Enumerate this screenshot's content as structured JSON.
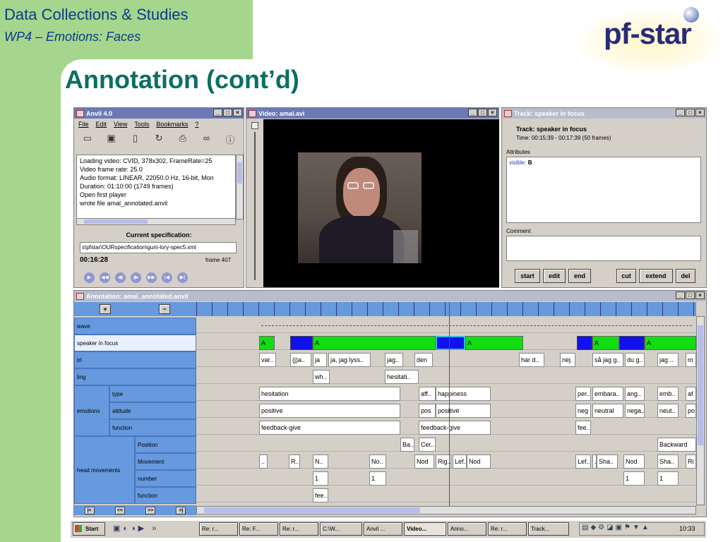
{
  "slide": {
    "header_title": "Data Collections & Studies",
    "header_subtitle": "WP4 – Emotions: Faces",
    "main_title": "Annotation (cont’d)",
    "logo_text": "pf-star",
    "colors": {
      "header_bg": "#a6d68d",
      "title": "#0b6e64",
      "accent": "#6b7ab5"
    }
  },
  "anvil": {
    "title": "Anvil 4.0",
    "menu": [
      "File",
      "Edit",
      "View",
      "Tools",
      "Bookmarks",
      "?"
    ],
    "log": [
      "Loading video: CVID, 378x302, FrameRate=25",
      "Video frame rate: 25.0",
      "Audio format: LINEAR, 22050.0 Hz, 16-bit, Mon",
      "Duration: 01:10:00 (1749 frames)",
      "Open first player",
      "wrote file amal_annotated.anvil"
    ],
    "spec_label": "Current specification:",
    "spec_path": "s\\pfstar\\OURspecification\\guni-lory-spec5.xml",
    "time": "00:16:28",
    "frame": "frame 407"
  },
  "video": {
    "title": "Video: amal.avi"
  },
  "track": {
    "title": "Track: speaker in focus",
    "name": "Track: speaker in focus",
    "time": "Time: 00:15:39 - 00:17:39 (50 frames)",
    "attributes_label": "Attributes",
    "attr_key": "visible:",
    "attr_val": "B",
    "comment_label": "Comment",
    "buttons": [
      "start",
      "edit",
      "end",
      "cut",
      "extend",
      "del"
    ]
  },
  "annotation": {
    "title": "Annotation: amal_annotated.anvil",
    "zoom_in": "+",
    "zoom_out": "−",
    "tracks": {
      "wave": "wave",
      "speaker": "speaker in focus",
      "trl": "trl",
      "ling": "ling",
      "emotions": "emotions",
      "type": "type",
      "attitude": "attitude",
      "function": "function",
      "head": "head movements",
      "position": "Position",
      "movement": "Movement",
      "number": "number",
      "hfunction": "function"
    },
    "speaker_labels": [
      "A",
      "A",
      "A",
      "A",
      "A"
    ],
    "trl": [
      "var..",
      "(j)a..",
      "ja",
      "ja, jag lyss..",
      "jag..",
      "den",
      "har d..",
      "nej.",
      "så jag g..",
      "du g..",
      "jag ..",
      "m"
    ],
    "ling": [
      "wh..",
      "hesitati.."
    ],
    "type": [
      "hesitation",
      "aff..",
      "happiness",
      "per..",
      "embara..",
      "ang..",
      "emb..",
      "af"
    ],
    "attitude": [
      "positive",
      "pos",
      "positive",
      "neg",
      "neutral",
      "nega..",
      "neut..",
      "po"
    ],
    "function": [
      "feedback-give",
      "feedback-give",
      "fee.."
    ],
    "position": [
      "Ba..",
      "Cer..",
      "Backward"
    ],
    "movement": [
      "..",
      "R..",
      "N..",
      "No..",
      "Nod",
      "Rig..",
      "Lef..",
      "Nod",
      "Lef..",
      "..",
      "Sha..",
      "Nod",
      "Sha..",
      "Ri"
    ],
    "number": [
      "1",
      "1",
      "1",
      "1"
    ],
    "hfunction": [
      "fee.."
    ],
    "nav": [
      "|<",
      "<<",
      ">>",
      ">|"
    ]
  },
  "taskbar": {
    "start": "Start",
    "items": [
      "Re: r...",
      "Re: F...",
      "Re: r...",
      "C:\\W...",
      "Anvil ...",
      "Video...",
      "Anno...",
      "Re: r...",
      "Track..."
    ],
    "clock": "10:33"
  }
}
